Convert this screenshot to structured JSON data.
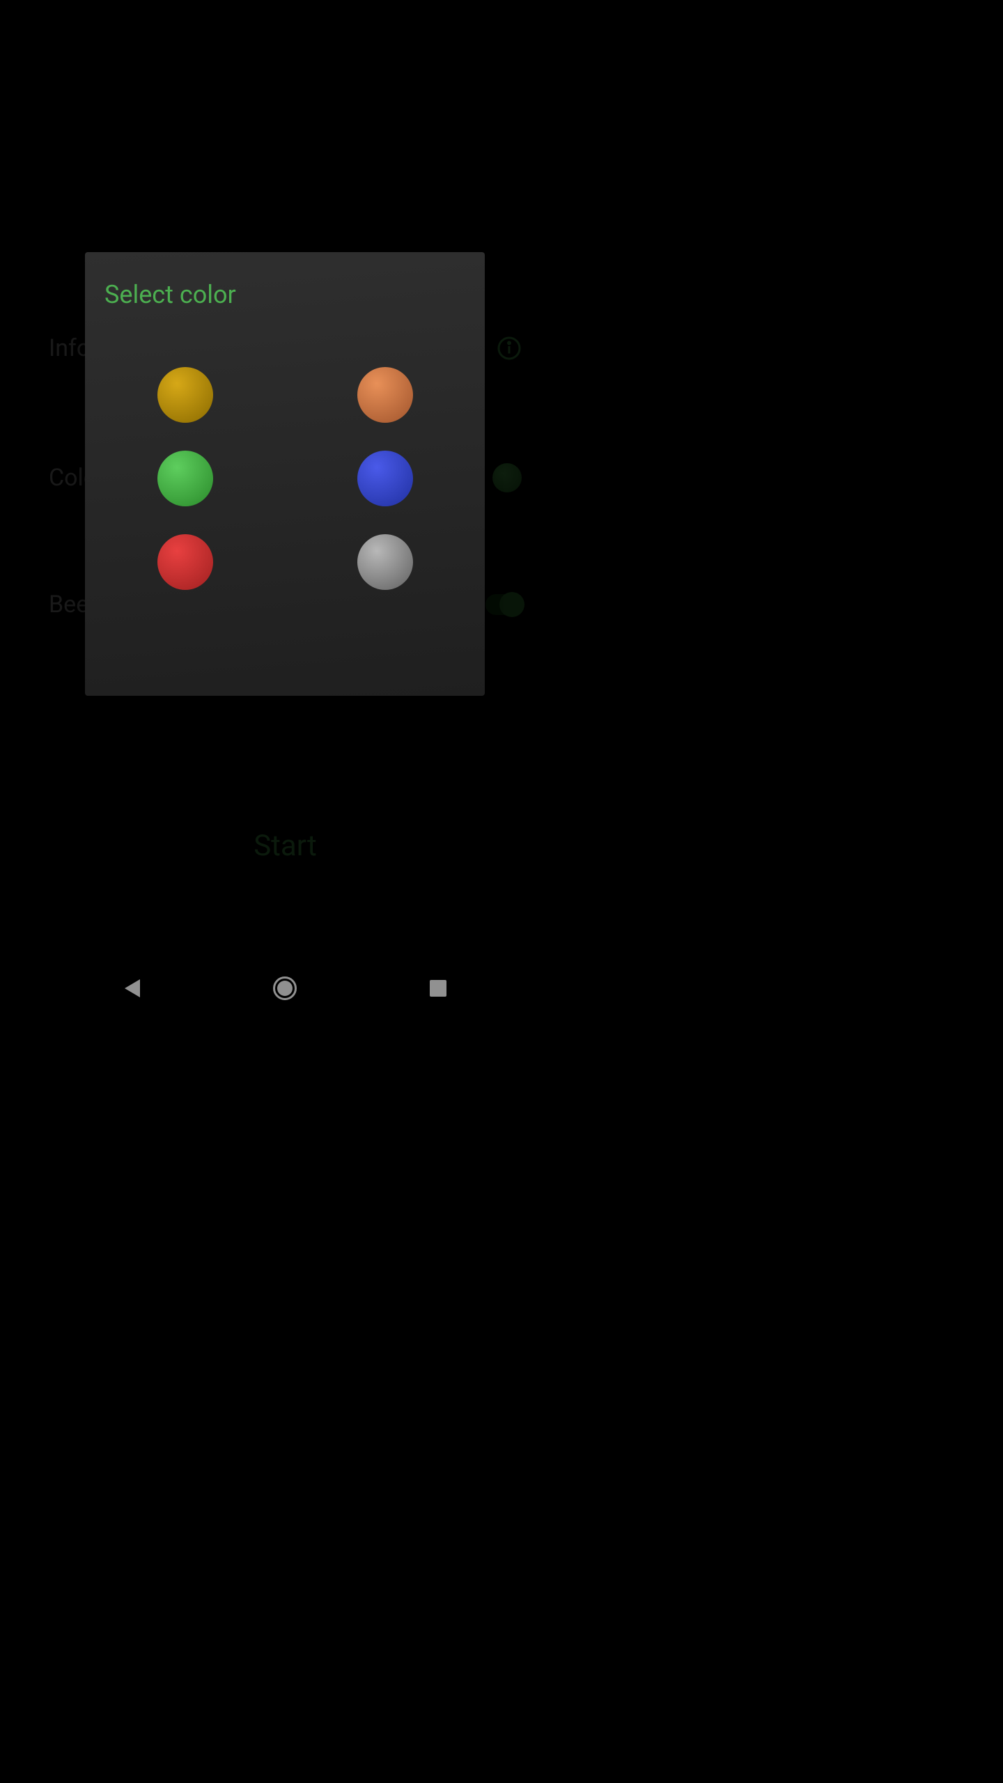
{
  "background": {
    "info_label": "Info",
    "color_label": "Color",
    "beep_label": "Beep",
    "start_label": "Start"
  },
  "dialog": {
    "title": "Select color",
    "colors": [
      {
        "name": "olive",
        "hex": "#b08c00"
      },
      {
        "name": "orange",
        "hex": "#c97040"
      },
      {
        "name": "green",
        "hex": "#45b045"
      },
      {
        "name": "blue",
        "hex": "#3545d0"
      },
      {
        "name": "red",
        "hex": "#c93030"
      },
      {
        "name": "gray",
        "hex": "#888888"
      }
    ]
  },
  "nav": {
    "back": "back",
    "home": "home",
    "recent": "recent"
  }
}
